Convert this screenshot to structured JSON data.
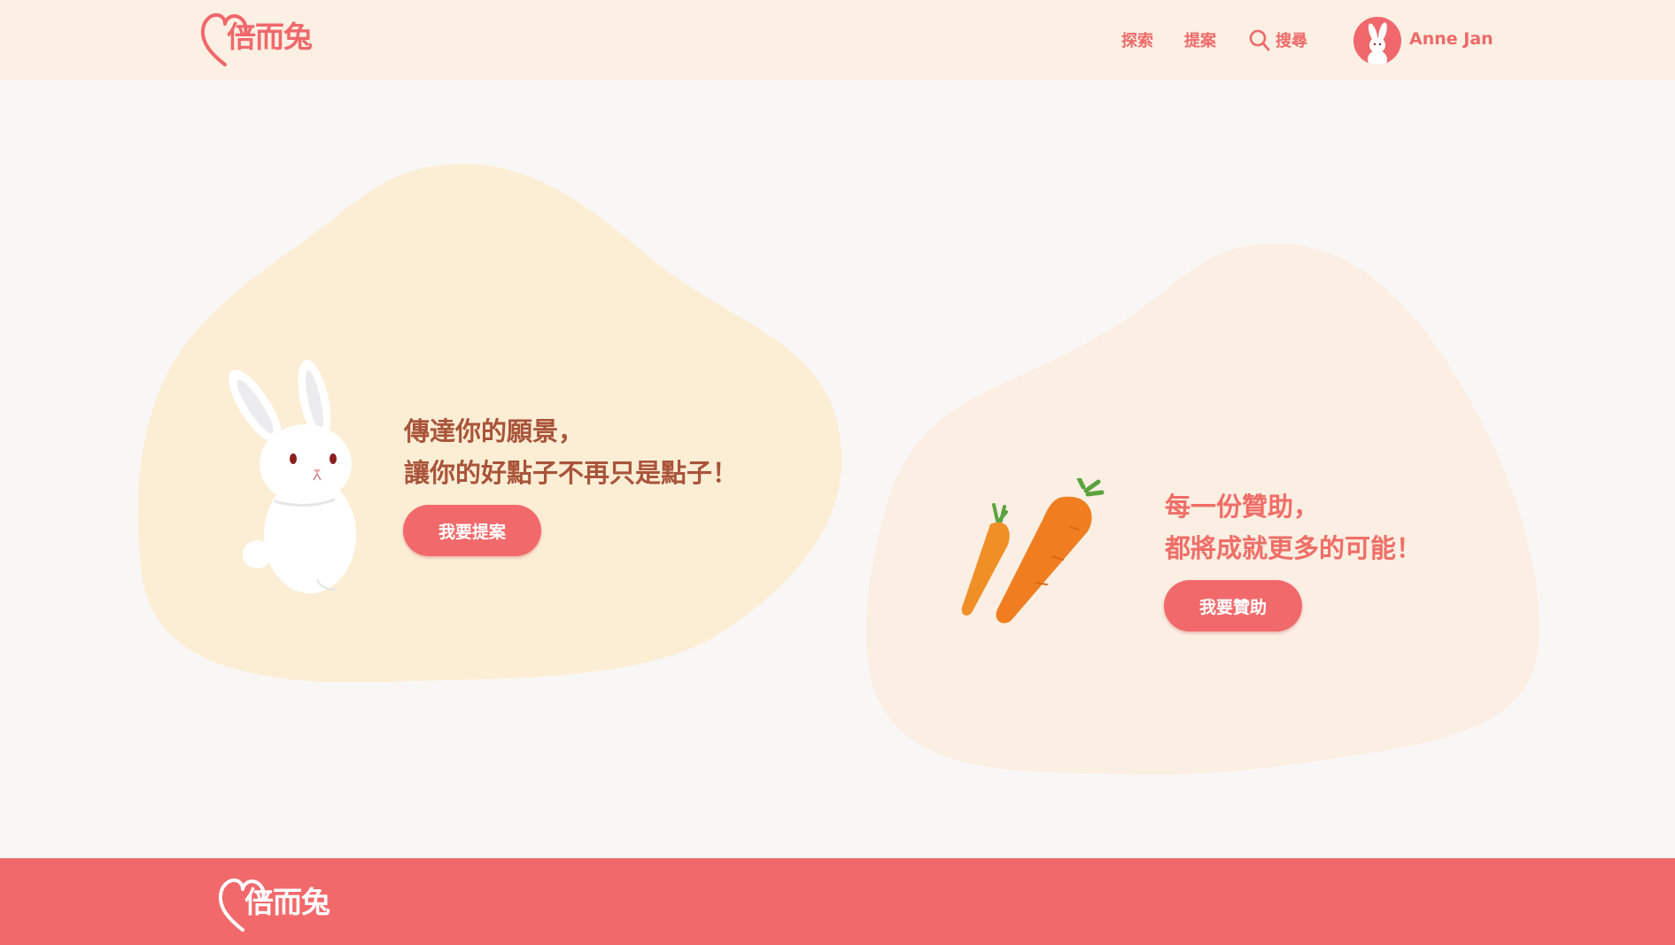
{
  "header": {
    "logo_text": "倍而兔",
    "nav": {
      "explore": "探索",
      "propose": "提案",
      "search": "搜尋"
    },
    "user_name": "Anne Jan"
  },
  "main": {
    "proposal": {
      "line1": "傳達你的願景，",
      "line2": "讓你的好點子不再只是點子！",
      "button": "我要提案"
    },
    "sponsor": {
      "line1": "每一份贊助，",
      "line2": "都將成就更多的可能！",
      "button": "我要贊助"
    }
  },
  "footer": {
    "logo_text": "倍而兔"
  },
  "colors": {
    "brand": "#f2696b",
    "header_bg": "#fcefe3",
    "proposal_blob": "#fbeed5",
    "sponsor_blob": "#fbeee2",
    "headline_brown": "#a9543a",
    "headline_coral": "#ef6e67"
  }
}
